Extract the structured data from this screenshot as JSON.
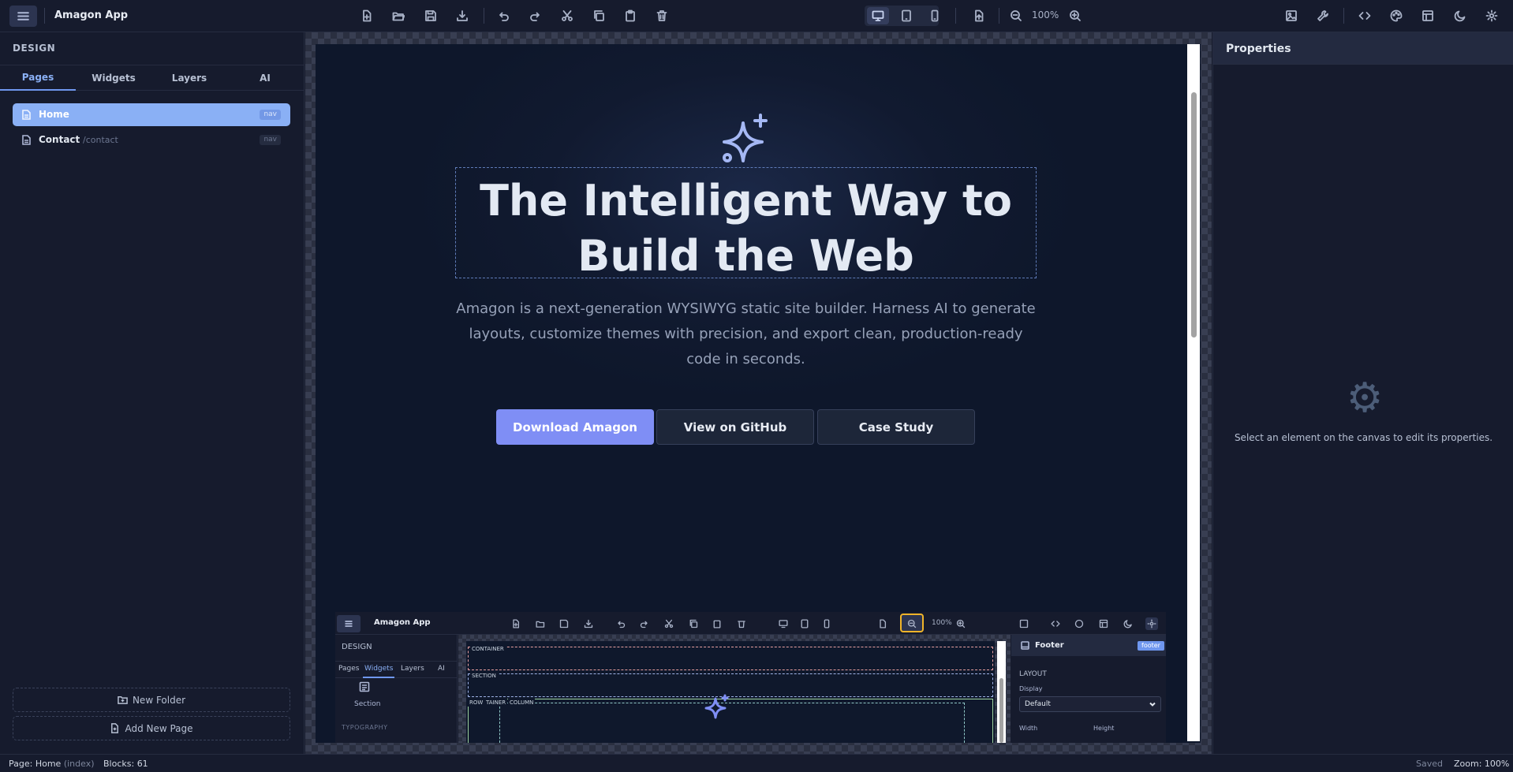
{
  "app": {
    "title": "Amagon App",
    "zoom": "100%"
  },
  "sidebar": {
    "heading": "DESIGN",
    "tabs": [
      {
        "label": "Pages",
        "active": true
      },
      {
        "label": "Widgets",
        "active": false
      },
      {
        "label": "Layers",
        "active": false
      },
      {
        "label": "AI",
        "active": false
      }
    ],
    "pages": [
      {
        "name": "Home",
        "slug": "",
        "badge": "nav",
        "active": true
      },
      {
        "name": "Contact",
        "slug": "/contact",
        "badge": "nav",
        "active": false
      }
    ],
    "new_folder": "New Folder",
    "add_page": "Add New Page"
  },
  "canvas": {
    "headline": "The Intelligent Way to Build the Web",
    "subtitle": "Amagon is a next-generation WYSIWYG static site builder. Harness AI to generate layouts, customize themes with precision, and export clean, production-ready code in seconds.",
    "cta_primary": "Download Amagon",
    "cta_secondary": "View on GitHub",
    "cta_tertiary": "Case Study"
  },
  "mini": {
    "title": "Amagon App",
    "zoom": "100%",
    "design": "DESIGN",
    "tabs": [
      "Pages",
      "Widgets",
      "Layers",
      "AI"
    ],
    "section_label": "Section",
    "typography": "TYPOGRAPHY",
    "outlines": {
      "container": "CONTAINER",
      "section": "SECTION",
      "row": "ROW",
      "container2": "TAINER",
      "column": "COLUMN"
    },
    "props": {
      "title": "Footer",
      "badge": "footer",
      "layout": "LAYOUT",
      "display_label": "Display",
      "display_value": "Default",
      "width_label": "Width",
      "height_label": "Height"
    }
  },
  "properties": {
    "title": "Properties",
    "hint": "Select an element on the canvas to edit its properties."
  },
  "statusbar": {
    "page_label": "Page:",
    "page_name": "Home",
    "page_index": "(index)",
    "blocks_label": "Blocks:",
    "blocks_count": "61",
    "saved": "Saved",
    "zoom_label": "Zoom:",
    "zoom_value": "100%"
  }
}
